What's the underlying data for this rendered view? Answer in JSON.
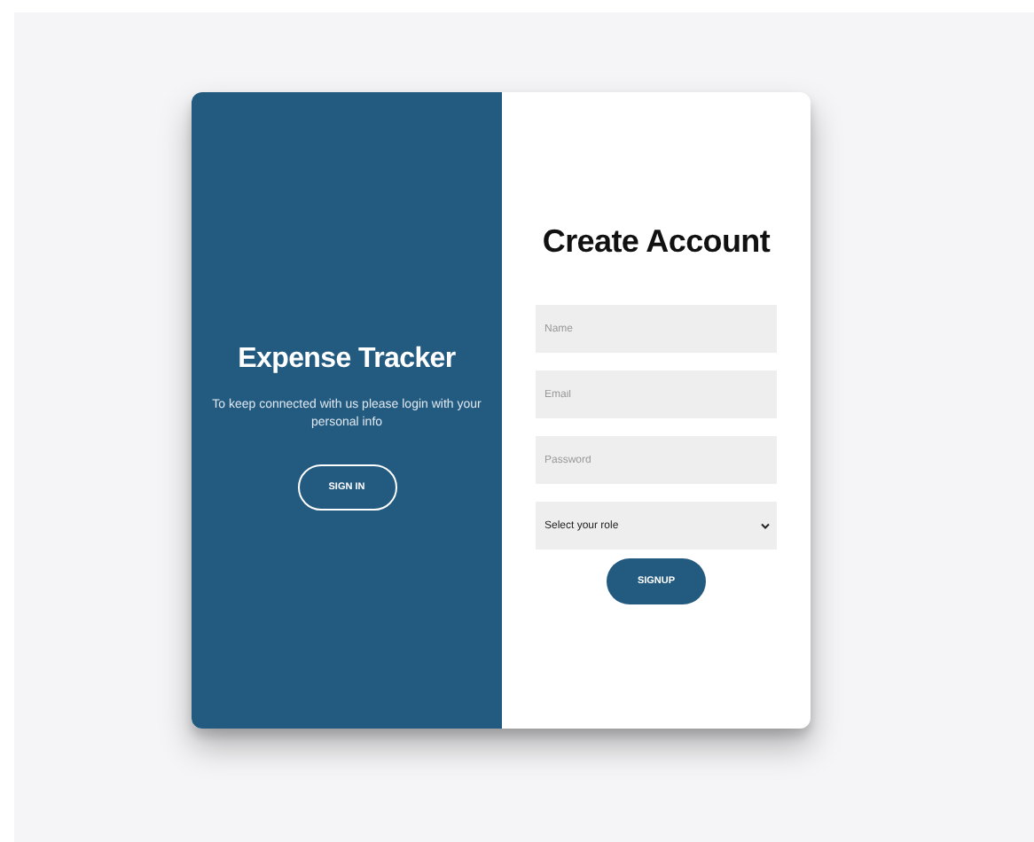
{
  "overlay": {
    "title": "Expense Tracker",
    "text": "To keep connected with us please login with your personal info",
    "button": "SIGN IN"
  },
  "form": {
    "title": "Create Account",
    "fields": [
      {
        "placeholder": "Name"
      },
      {
        "placeholder": "Email"
      },
      {
        "placeholder": "Password"
      }
    ],
    "role_select": {
      "value": "Select your role"
    },
    "button": "SIGNUP"
  }
}
